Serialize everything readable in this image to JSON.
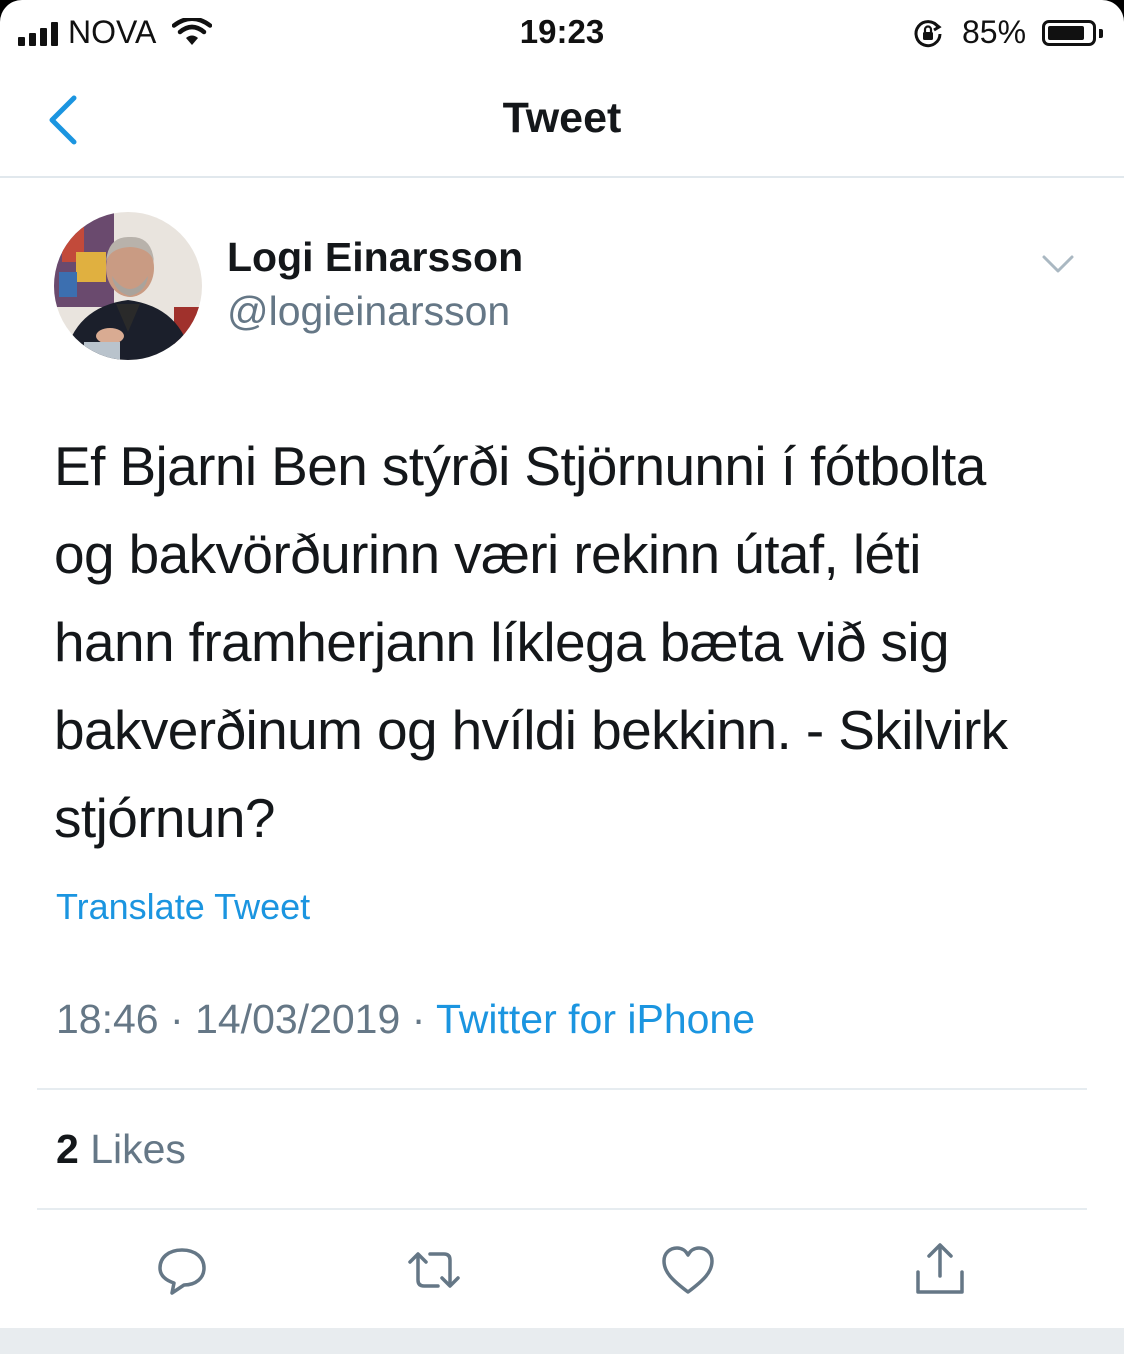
{
  "status_bar": {
    "carrier": "NOVA",
    "time": "19:23",
    "battery_percent": "85%",
    "battery_level": 0.85,
    "signal_bars": 4
  },
  "nav": {
    "title": "Tweet",
    "back_icon": "chevron-left-icon"
  },
  "tweet": {
    "display_name": "Logi Einarsson",
    "handle": "@logieinarsson",
    "text": "Ef Bjarni Ben stýrði Stjörnunni í fótbolta\nog bakvörðurinn væri rekinn útaf, léti\nhann framherjann líklega bæta við sig\nbakverðinum og hvíldi bekkinn. - Skilvirk\nstjórnun?",
    "translate_label": "Translate Tweet",
    "time": "18:46",
    "separator": "·",
    "date": "14/03/2019",
    "source": "Twitter for iPhone",
    "likes_count": "2",
    "likes_label": "Likes"
  },
  "actions": [
    {
      "name": "reply",
      "icon": "reply-icon"
    },
    {
      "name": "retweet",
      "icon": "retweet-icon"
    },
    {
      "name": "like",
      "icon": "heart-icon"
    },
    {
      "name": "share",
      "icon": "share-icon"
    }
  ],
  "colors": {
    "accent": "#1b95e0",
    "text_primary": "#14171a",
    "text_secondary": "#657786",
    "divider": "#e6ecf0"
  }
}
